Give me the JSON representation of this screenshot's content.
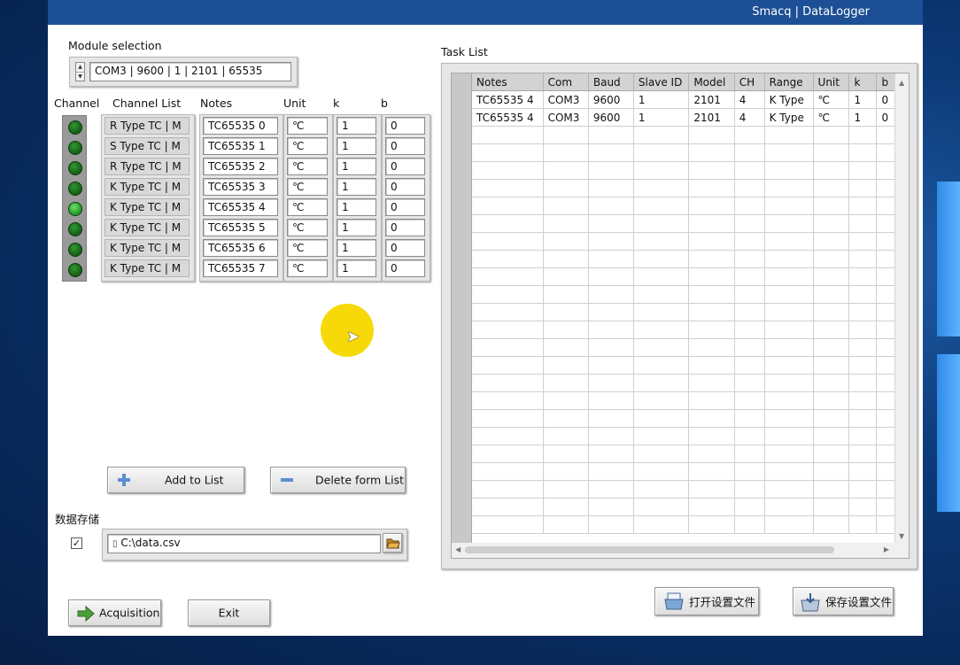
{
  "window": {
    "title": "Smacq | DataLogger"
  },
  "module": {
    "label": "Module selection",
    "value": "COM3 | 9600 | 1 | 2101 | 65535"
  },
  "channel_headers": {
    "channel": "Channel",
    "list": "Channel List",
    "notes": "Notes",
    "unit": "Unit",
    "k": "k",
    "b": "b"
  },
  "channels": [
    {
      "type": "R Type TC | M",
      "note": "TC65535 0",
      "unit": "℃",
      "k": "1",
      "b": "0"
    },
    {
      "type": "S Type TC | M",
      "note": "TC65535 1",
      "unit": "℃",
      "k": "1",
      "b": "0"
    },
    {
      "type": "R Type TC | M",
      "note": "TC65535 2",
      "unit": "℃",
      "k": "1",
      "b": "0"
    },
    {
      "type": "K Type TC | M",
      "note": "TC65535 3",
      "unit": "℃",
      "k": "1",
      "b": "0"
    },
    {
      "type": "K Type TC | M",
      "note": "TC65535 4",
      "unit": "℃",
      "k": "1",
      "b": "0"
    },
    {
      "type": "K Type TC | M",
      "note": "TC65535 5",
      "unit": "℃",
      "k": "1",
      "b": "0"
    },
    {
      "type": "K Type TC | M",
      "note": "TC65535 6",
      "unit": "℃",
      "k": "1",
      "b": "0"
    },
    {
      "type": "K Type TC | M",
      "note": "TC65535 7",
      "unit": "℃",
      "k": "1",
      "b": "0"
    }
  ],
  "buttons": {
    "add": "Add to List",
    "delete": "Delete form List",
    "acquisition": "Acquisition",
    "exit": "Exit",
    "open_settings": "打开设置文件",
    "save_settings": "保存设置文件"
  },
  "storage": {
    "label": "数据存储",
    "checked": true,
    "path": "C:\\data.csv"
  },
  "task_list": {
    "label": "Task List",
    "columns": [
      "Notes",
      "Com",
      "Baud",
      "Slave ID",
      "Model",
      "CH",
      "Range",
      "Unit",
      "k",
      "b"
    ],
    "rows": [
      [
        "TC65535 4",
        "COM3",
        "9600",
        "1",
        "2101",
        "4",
        "K Type",
        "℃",
        "1",
        "0"
      ],
      [
        "TC65535 4",
        "COM3",
        "9600",
        "1",
        "2101",
        "4",
        "K Type",
        "℃",
        "1",
        "0"
      ]
    ]
  },
  "colors": {
    "titlebar": "#1c4f95",
    "led": "#1a6a1a",
    "led_active": "#2fa62f",
    "cursor_highlight": "#f7d90a"
  }
}
